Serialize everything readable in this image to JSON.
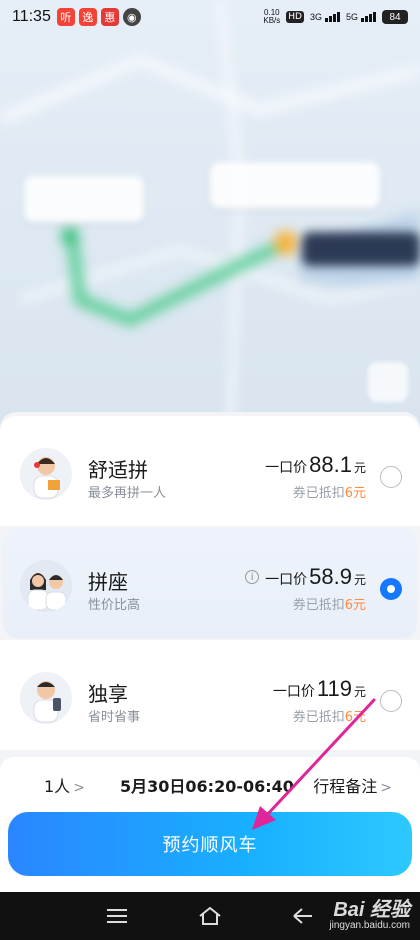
{
  "status_bar": {
    "time": "11:35",
    "app_badges": [
      {
        "icon": "news-app-icon",
        "glyph": "听",
        "color": "#f44336"
      },
      {
        "icon": "express-app-icon",
        "glyph": "逸",
        "color": "#f44336"
      },
      {
        "icon": "shop-app-icon",
        "glyph": "惠",
        "color": "#e53935"
      },
      {
        "icon": "pin-app-icon",
        "glyph": "◉",
        "color": "#444444"
      }
    ],
    "net_speed": "0.10",
    "net_unit": "KB/s",
    "hd": "HD",
    "sig1": "3G",
    "sig2": "5G",
    "battery": "84"
  },
  "ride_options": [
    {
      "title": "舒适拼",
      "subtitle": "最多再拼一人",
      "price_prefix": "一口价",
      "price": "88.1",
      "unit": "元",
      "coupon_text": "券已抵扣",
      "coupon_amount": "6元",
      "selected": false,
      "avatar": "carpool-comfort-avatar"
    },
    {
      "title": "拼座",
      "subtitle": "性价比高",
      "price_prefix": "一口价",
      "price": "58.9",
      "unit": "元",
      "coupon_text": "券已抵扣",
      "coupon_amount": "6元",
      "selected": true,
      "avatar": "carpool-seat-avatar"
    },
    {
      "title": "独享",
      "subtitle": "省时省事",
      "price_prefix": "一口价",
      "price": "119",
      "unit": "元",
      "coupon_text": "券已抵扣",
      "coupon_amount": "6元",
      "selected": false,
      "avatar": "exclusive-ride-avatar"
    }
  ],
  "info_row": {
    "persons": "1人",
    "time": "5月30日06:20-06:40",
    "notes": "行程备注"
  },
  "cta": {
    "label": "预约顺风车"
  },
  "colors": {
    "accent": "#1677ff",
    "coupon": "#ff8a3d",
    "arrow": "#e0249a"
  },
  "watermark": {
    "main": "Bai 经验",
    "sub": "jingyan.baidu.com"
  }
}
